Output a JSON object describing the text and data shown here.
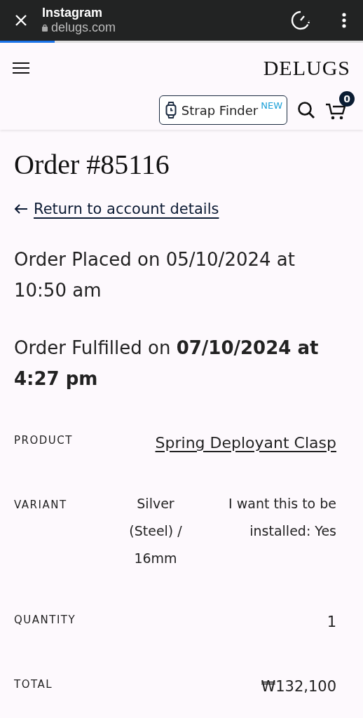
{
  "browser_bar": {
    "title": "Instagram",
    "url": "delugs.com",
    "level": 0.15
  },
  "header": {
    "logo": "DELUGS",
    "strap_finder": {
      "label": "Strap Finder",
      "badge": "NEW"
    },
    "cart_count": "0"
  },
  "order": {
    "title": "Order #85116",
    "back_link": "Return to account details",
    "placed": "Order Placed on 05/10/2024 at 10:50 am",
    "fulfilled": "Order Fulfilled on **07/10/2024 at 4:27 pm**",
    "details": [
      {
        "kind": "link",
        "label": "PRODUCT",
        "value": "Spring Deployant Clasp"
      },
      {
        "kind": "parts",
        "label": "VARIANT",
        "values": [
          "Silver (Steel) / 16mm",
          "I want this to be installed: Yes"
        ]
      },
      {
        "kind": "text",
        "label": "QUANTITY",
        "value": "1"
      },
      {
        "kind": "text",
        "label": "TOTAL",
        "value": "₩132,100"
      }
    ]
  }
}
